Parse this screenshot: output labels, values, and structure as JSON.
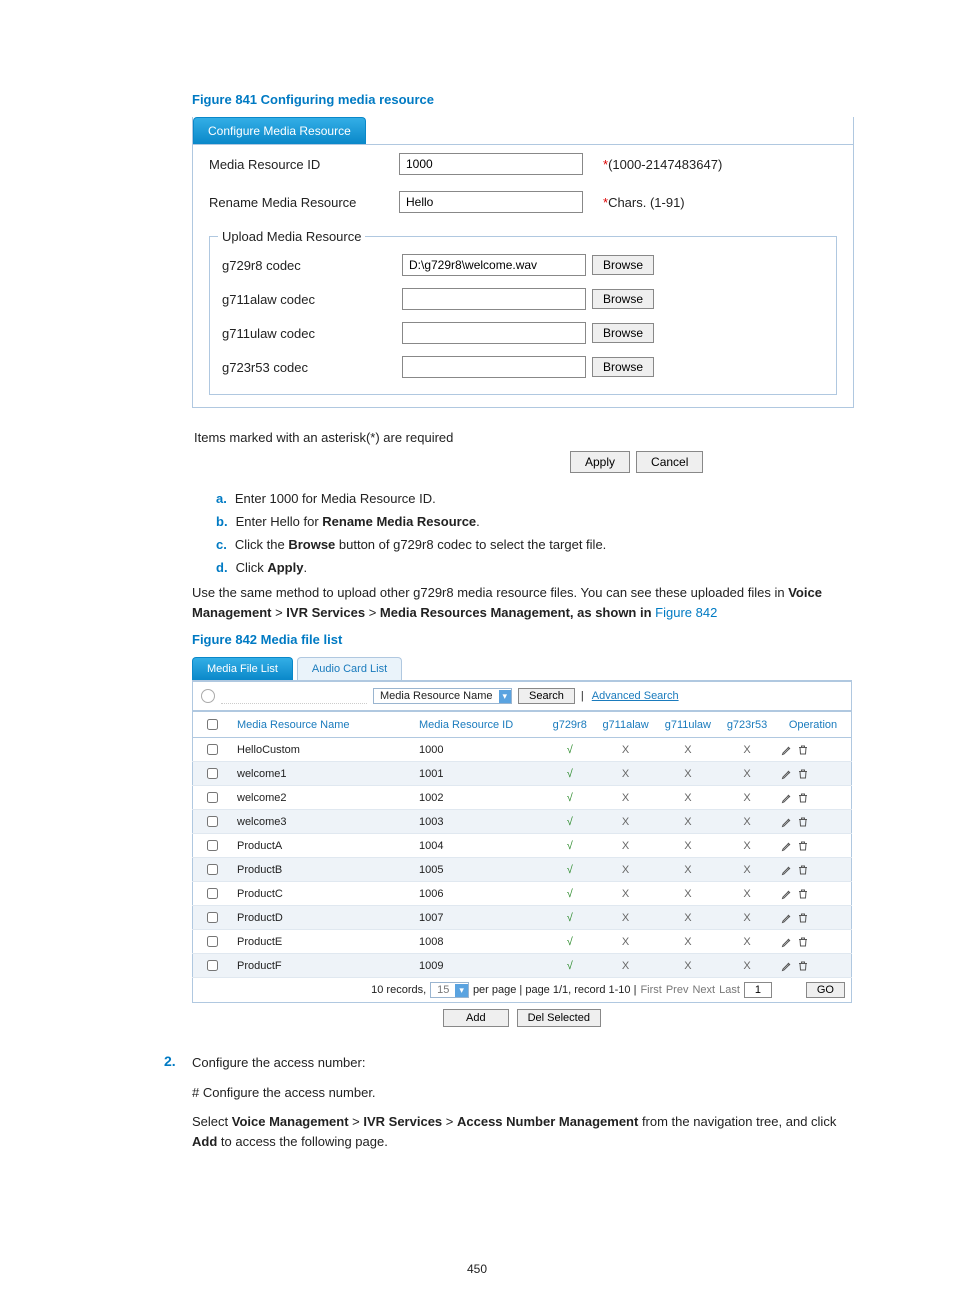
{
  "fig841": {
    "caption": "Figure 841 Configuring media resource",
    "tab": "Configure Media Resource",
    "rows": {
      "id_label": "Media Resource ID",
      "id_value": "1000",
      "id_hint_star": "*",
      "id_hint": "(1000-2147483647)",
      "name_label": "Rename Media Resource",
      "name_value": "Hello",
      "name_hint_star": "*",
      "name_hint": "Chars. (1-91)"
    },
    "upload": {
      "legend": "Upload Media Resource",
      "rows": [
        {
          "label": "g729r8 codec",
          "value": "D:\\g729r8\\welcome.wav"
        },
        {
          "label": "g711alaw codec",
          "value": ""
        },
        {
          "label": "g711ulaw codec",
          "value": ""
        },
        {
          "label": "g723r53 codec",
          "value": ""
        }
      ],
      "browse": "Browse"
    },
    "required_note": "Items marked with an asterisk(*) are required",
    "apply": "Apply",
    "cancel": "Cancel"
  },
  "steps": {
    "a": "Enter 1000 for Media Resource ID.",
    "b_pre": "Enter Hello for ",
    "b_bold": "Rename Media Resource",
    "b_post": ".",
    "c_pre": "Click the ",
    "c_bold": "Browse",
    "c_post": " button of g729r8 codec to select the target file.",
    "d_pre": "Click ",
    "d_bold": "Apply",
    "d_post": "."
  },
  "mid_para": {
    "t1": "Use the same method to upload other g729r8 media resource files. You can see these uploaded files in ",
    "b1": "Voice Management",
    "gt": " > ",
    "b2": "IVR Services",
    "b3": "Media Resources Management, as shown in ",
    "link": "Figure 842"
  },
  "fig842": {
    "caption": "Figure 842 Media file list",
    "tab_a": "Media File List",
    "tab_b": "Audio Card List",
    "search": {
      "sel": "Media Resource Name",
      "btn": "Search",
      "adv": "Advanced Search"
    },
    "headers": {
      "name": "Media Resource Name",
      "id": "Media Resource ID",
      "c1": "g729r8",
      "c2": "g711alaw",
      "c3": "g711ulaw",
      "c4": "g723r53",
      "op": "Operation"
    },
    "rows": [
      {
        "name": "HelloCustom",
        "id": "1000"
      },
      {
        "name": "welcome1",
        "id": "1001"
      },
      {
        "name": "welcome2",
        "id": "1002"
      },
      {
        "name": "welcome3",
        "id": "1003"
      },
      {
        "name": "ProductA",
        "id": "1004"
      },
      {
        "name": "ProductB",
        "id": "1005"
      },
      {
        "name": "ProductC",
        "id": "1006"
      },
      {
        "name": "ProductD",
        "id": "1007"
      },
      {
        "name": "ProductE",
        "id": "1008"
      },
      {
        "name": "ProductF",
        "id": "1009"
      }
    ],
    "footer": {
      "records": "10 records,",
      "perpage_val": "15",
      "perpage_txt": "per page | page 1/1, record 1-10 |",
      "first": "First",
      "prev": "Prev",
      "next": "Next",
      "last": "Last",
      "page_val": "1",
      "go": "GO"
    },
    "add": "Add",
    "del": "Del Selected"
  },
  "step2": {
    "num": "2.",
    "line1": "Configure the access number:",
    "line2": "# Configure the access number.",
    "line3_pre": "Select ",
    "b1": "Voice Management",
    "gt": " > ",
    "b2": "IVR Services",
    "b3": "Access Number Management",
    "line3_mid": " from the navigation tree, and click ",
    "b4": "Add",
    "line3_post": " to access the following page."
  },
  "page_number": "450"
}
